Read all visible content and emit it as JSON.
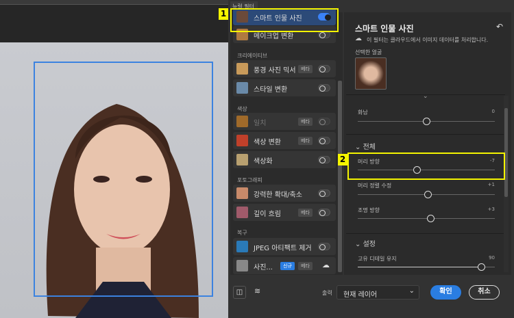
{
  "panel": {
    "tab": "뉴럴 필터"
  },
  "filters": {
    "top": [
      {
        "label": "스마트 인물 사진",
        "on": true
      },
      {
        "label": "메이크업 변환",
        "on": false
      }
    ],
    "creative_header": "크리에이티브",
    "creative": [
      {
        "label": "풍경 사진 믹서",
        "badge": "베타"
      },
      {
        "label": "스타일 변환"
      }
    ],
    "color_header": "색상",
    "color": [
      {
        "label": "일치",
        "badge": "베타"
      },
      {
        "label": "색상 변환",
        "badge": "베타"
      },
      {
        "label": "색상화"
      }
    ],
    "photo_header": "포토그래피",
    "photo": [
      {
        "label": "강력한 확대/축소"
      },
      {
        "label": "깊이 흐림",
        "badge": "베타"
      }
    ],
    "restore_header": "복구",
    "restore": [
      {
        "label": "JPEG 아티팩트 제거"
      },
      {
        "label": "사진...",
        "new": "신규",
        "badge": "베타"
      }
    ]
  },
  "detail": {
    "title": "스마트 인물 사진",
    "cloud_note": "이 필터는 클라우드에서 이미지 데이터를 처리합니다.",
    "selected_face": "선택한 얼굴",
    "anger": {
      "label": "화남",
      "value": "0",
      "frac": 0.5
    },
    "overall": "전체",
    "head_dir": {
      "label": "머리 방향",
      "value": "-7",
      "frac": 0.43
    },
    "head_align": {
      "label": "머리 정렬 수정",
      "value": "+1",
      "frac": 0.51
    },
    "light_dir": {
      "label": "조명 방향",
      "value": "+3",
      "frac": 0.53
    },
    "settings": "설정",
    "detail_keep": {
      "label": "고유 디테일 유지",
      "value": "90",
      "frac": 0.9
    }
  },
  "footer": {
    "output_label": "출력",
    "output_value": "현재 레이어",
    "ok": "확인",
    "cancel": "취소"
  },
  "annotations": {
    "one": "1",
    "two": "2"
  }
}
